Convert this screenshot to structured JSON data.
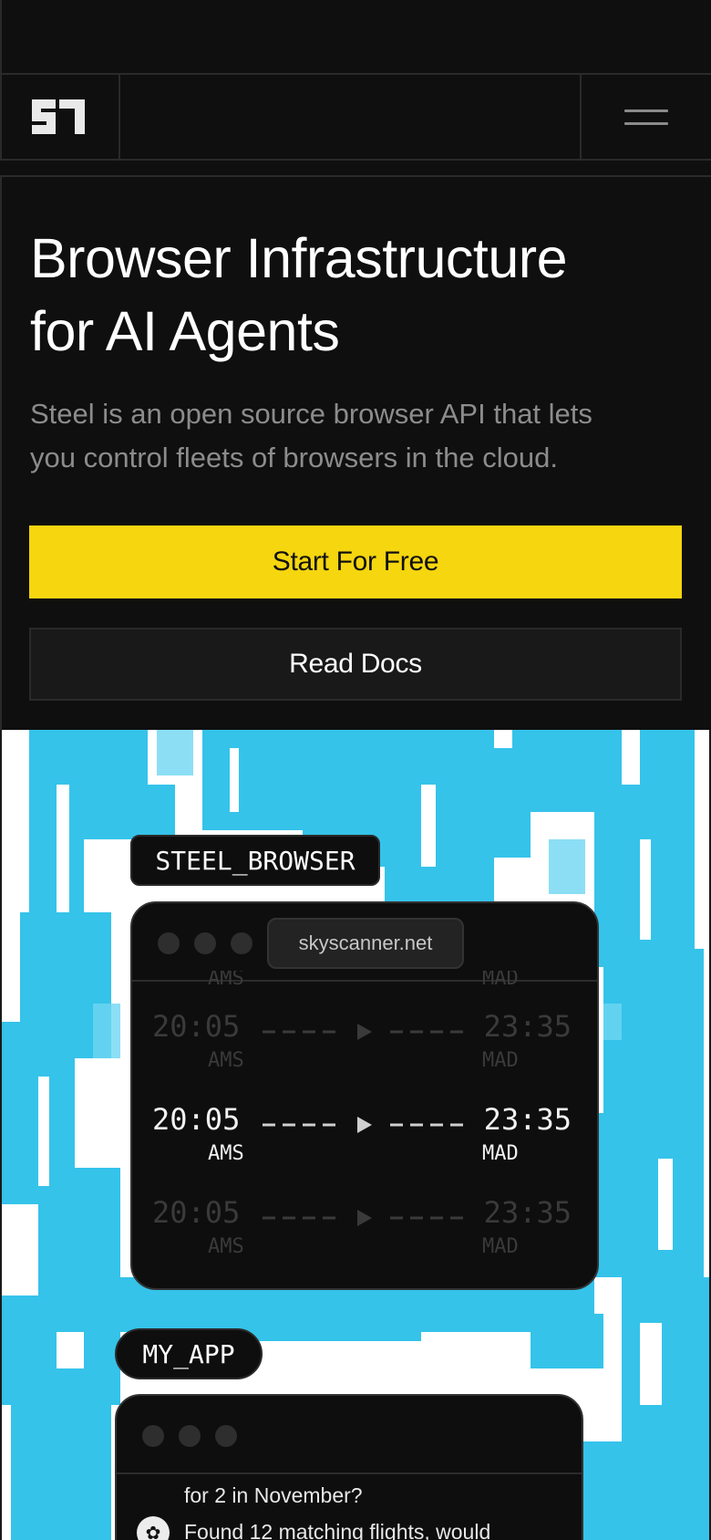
{
  "brand": {
    "logo_text": "S1",
    "logo_icon": "steel-logo-icon"
  },
  "nav": {
    "menu_icon": "hamburger-menu-icon"
  },
  "hero": {
    "title_line1": "Browser Infrastructure",
    "title_line2": "for AI Agents",
    "subtitle_line1": "Steel is an open source browser API that lets",
    "subtitle_line2": "you control fleets of browsers in the cloud.",
    "primary_cta": "Start For Free",
    "secondary_cta": "Read Docs"
  },
  "colors": {
    "accent": "#f5d60f",
    "art_blue": "#35c3ea",
    "background": "#0f0f0f"
  },
  "steel_browser": {
    "tag": "STEEL_BROWSER",
    "url": "skyscanner.net",
    "partial_top": {
      "dep_code": "AMS",
      "arr_code": "MAD"
    },
    "flights": [
      {
        "dep_time": "20:05",
        "dep_code": "AMS",
        "arr_time": "23:35",
        "arr_code": "MAD",
        "state": "dim"
      },
      {
        "dep_time": "20:05",
        "dep_code": "AMS",
        "arr_time": "23:35",
        "arr_code": "MAD",
        "state": "active"
      },
      {
        "dep_time": "20:05",
        "dep_code": "AMS",
        "arr_time": "23:35",
        "arr_code": "MAD",
        "state": "dim"
      }
    ]
  },
  "my_app": {
    "tag": "MY_APP",
    "user_message_tail": "for 2 in November?",
    "assistant_message": "Found 12 matching flights, would",
    "assistant_icon": "openai-icon"
  }
}
